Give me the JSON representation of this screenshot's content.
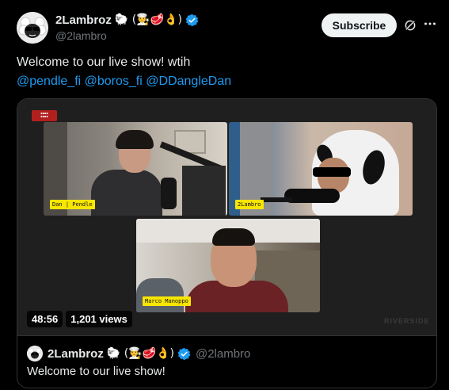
{
  "author": {
    "display_name": "2Lambroz",
    "emoji": "🐑 (🧑‍🍳🥩👌)",
    "handle": "@2lambro",
    "avatar_icon": "sheep-with-sunglasses-avatar"
  },
  "actions": {
    "subscribe_label": "Subscribe",
    "grok_icon": "grok-icon",
    "more_icon": "more-options-icon"
  },
  "tweet": {
    "text": "Welcome to our live show! wtih",
    "mentions": [
      "@pendle_fi",
      "@boros_fi",
      "@DDangleDan"
    ]
  },
  "video": {
    "duration": "48:56",
    "views": "1,201 views",
    "tiles": [
      {
        "tag": "Dan | Pendle"
      },
      {
        "tag": "2Lambro"
      },
      {
        "tag": "Marco Manoppo"
      }
    ],
    "watermark": "RIVERSIDE"
  },
  "quote": {
    "display_name": "2Lambroz",
    "emoji": "🐑 (🧑‍🍳🥩👌)",
    "handle": "@2lambro",
    "text": "Welcome to our live show!"
  },
  "colors": {
    "background": "#000000",
    "text": "#e7e9ea",
    "muted": "#71767b",
    "link": "#1d9bf0",
    "verified": "#1d9bf0",
    "name_tag": "#f7e600"
  }
}
